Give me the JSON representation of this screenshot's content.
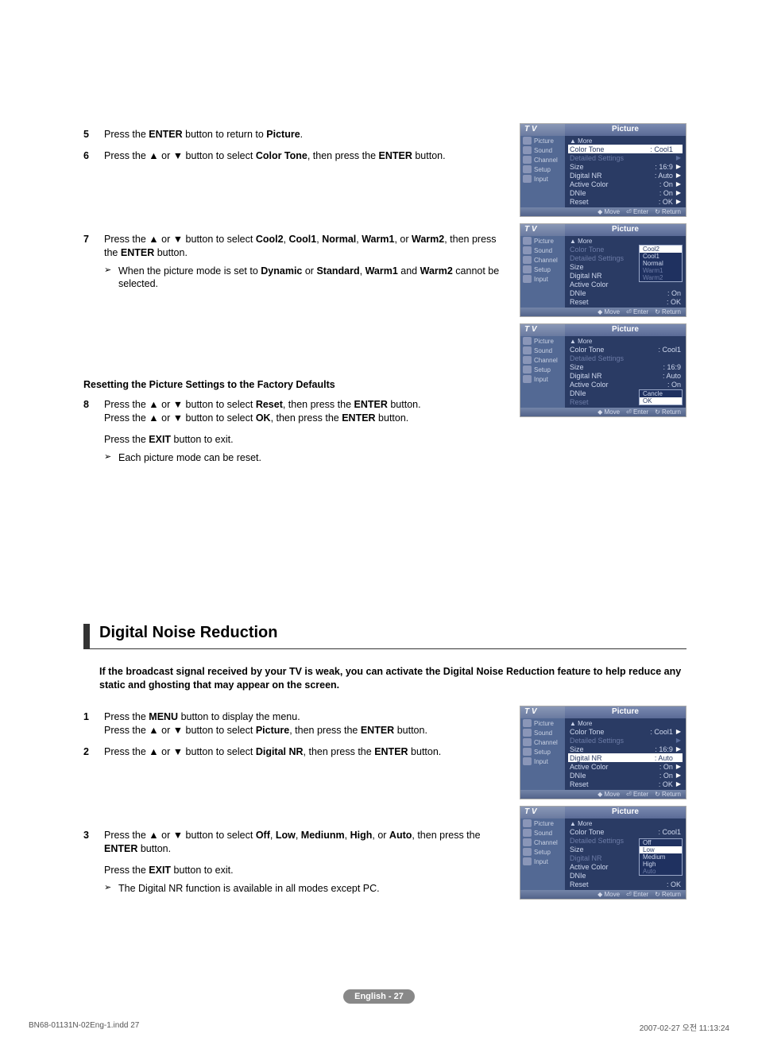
{
  "steps_top": [
    {
      "n": "5",
      "html": [
        "Press the ",
        [
          "b",
          "ENTER"
        ],
        " button to return to ",
        [
          "b",
          "Picture"
        ],
        "."
      ]
    },
    {
      "n": "6",
      "html": [
        "Press the ▲ or ▼ button to select ",
        [
          "b",
          "Color Tone"
        ],
        ", then press the ",
        [
          "b",
          "ENTER"
        ],
        " button."
      ]
    }
  ],
  "step7": {
    "n": "7",
    "html": [
      "Press the ▲ or ▼ button to select ",
      [
        "b",
        "Cool2"
      ],
      ", ",
      [
        "b",
        "Cool1"
      ],
      ", ",
      [
        "b",
        "Normal"
      ],
      ", ",
      [
        "b",
        "Warm1"
      ],
      ", or ",
      [
        "b",
        "Warm2"
      ],
      ", then press the ",
      [
        "b",
        "ENTER"
      ],
      " button."
    ],
    "sub": [
      "When the picture mode is set to ",
      [
        "b",
        "Dynamic"
      ],
      " or ",
      [
        "b",
        "Standard"
      ],
      ", ",
      [
        "b",
        "Warm1"
      ],
      " and ",
      [
        "b",
        "Warm2"
      ],
      " cannot be selected."
    ]
  },
  "reset_head": "Resetting the Picture Settings to the Factory Defaults",
  "step8": {
    "n": "8",
    "line1": [
      "Press the ▲ or ▼ button to select ",
      [
        "b",
        "Reset"
      ],
      ", then press the ",
      [
        "b",
        "ENTER"
      ],
      " button."
    ],
    "line2": [
      "Press the ▲ or ▼ button to select ",
      [
        "b",
        "OK"
      ],
      ", then press the ",
      [
        "b",
        "ENTER"
      ],
      " button."
    ],
    "exit": [
      "Press the ",
      [
        "b",
        "EXIT"
      ],
      " button to exit."
    ],
    "sub": [
      "Each picture mode can be reset."
    ]
  },
  "feature_title": "Digital Noise Reduction",
  "feature_intro": "If the broadcast signal received by your TV is weak, you can activate the Digital Noise Reduction feature to help reduce any static and ghosting that may appear on the screen.",
  "steps_dnr": [
    {
      "n": "1",
      "line1": [
        "Press the ",
        [
          "b",
          "MENU"
        ],
        " button to display the menu."
      ],
      "line2": [
        "Press the ▲ or ▼ button to select ",
        [
          "b",
          "Picture"
        ],
        ", then press the ",
        [
          "b",
          "ENTER"
        ],
        " button."
      ]
    },
    {
      "n": "2",
      "line1": [
        "Press the ▲ or ▼ button to select ",
        [
          "b",
          "Digital NR"
        ],
        ", then press the ",
        [
          "b",
          "ENTER"
        ],
        " button."
      ]
    }
  ],
  "step_dnr3": {
    "n": "3",
    "line1": [
      "Press the ▲ or ▼ button to select ",
      [
        "b",
        "Off"
      ],
      ", ",
      [
        "b",
        "Low"
      ],
      ", ",
      [
        "b",
        "Mediunm"
      ],
      ", ",
      [
        "b",
        "High"
      ],
      ", or ",
      [
        "b",
        "Auto"
      ],
      ", then press the ",
      [
        "b",
        "ENTER"
      ],
      " button."
    ],
    "exit": [
      "Press the ",
      [
        "b",
        "EXIT"
      ],
      " button to exit."
    ],
    "sub": [
      "The Digital NR function is available in all modes except PC."
    ]
  },
  "side_labels": [
    "Picture",
    "Sound",
    "Channel",
    "Setup",
    "Input"
  ],
  "osd": {
    "tv": "T V",
    "title": "Picture",
    "more": "▲ More",
    "bot": [
      "Move",
      "Enter",
      "Return"
    ]
  },
  "menu1_rows": [
    {
      "k": "Color Tone",
      "v": ": Cool1",
      "hi": true,
      "ar": true
    },
    {
      "k": "Detailed Settings",
      "v": "",
      "dim": true,
      "ar": true,
      "ardim": true
    },
    {
      "k": "Size",
      "v": ": 16:9",
      "ar": true
    },
    {
      "k": "Digital NR",
      "v": ": Auto",
      "ar": true
    },
    {
      "k": "Active Color",
      "v": ": On",
      "ar": true
    },
    {
      "k": "DNIe",
      "v": ": On",
      "ar": true
    },
    {
      "k": "Reset",
      "v": ": OK",
      "ar": true
    }
  ],
  "menu2_rows": [
    {
      "k": "Color Tone",
      "v": "",
      "dim": true
    },
    {
      "k": "Detailed Settings",
      "v": "",
      "dim": true
    },
    {
      "k": "Size",
      "v": ""
    },
    {
      "k": "Digital NR",
      "v": ""
    },
    {
      "k": "Active Color",
      "v": ""
    },
    {
      "k": "DNIe",
      "v": ": On"
    },
    {
      "k": "Reset",
      "v": ": OK"
    }
  ],
  "menu2_popup": [
    {
      "t": "Cool2",
      "hi": true
    },
    {
      "t": "Cool1"
    },
    {
      "t": "Normal"
    },
    {
      "t": "Warm1",
      "dim": true
    },
    {
      "t": "Warm2",
      "dim": true
    }
  ],
  "menu3_rows": [
    {
      "k": "Color Tone",
      "v": ": Cool1"
    },
    {
      "k": "Detailed Settings",
      "v": "",
      "dim": true
    },
    {
      "k": "Size",
      "v": ": 16:9"
    },
    {
      "k": "Digital NR",
      "v": ": Auto"
    },
    {
      "k": "Active Color",
      "v": ": On"
    },
    {
      "k": "DNIe",
      "v": ""
    },
    {
      "k": "Reset",
      "v": "",
      "dim": true
    }
  ],
  "menu3_popup": [
    {
      "t": "Cancle"
    },
    {
      "t": "OK",
      "hi": true
    }
  ],
  "menu4_rows": [
    {
      "k": "Color Tone",
      "v": ": Cool1",
      "ar": true
    },
    {
      "k": "Detailed Settings",
      "v": "",
      "dim": true,
      "ar": true,
      "ardim": true
    },
    {
      "k": "Size",
      "v": ": 16:9",
      "ar": true
    },
    {
      "k": "Digital NR",
      "v": ": Auto",
      "hi": true,
      "ar": true
    },
    {
      "k": "Active Color",
      "v": ": On",
      "ar": true
    },
    {
      "k": "DNIe",
      "v": ": On",
      "ar": true
    },
    {
      "k": "Reset",
      "v": ": OK",
      "ar": true
    }
  ],
  "menu5_rows": [
    {
      "k": "Color Tone",
      "v": ": Cool1"
    },
    {
      "k": "Detailed Settings",
      "v": "",
      "dim": true
    },
    {
      "k": "Size",
      "v": ""
    },
    {
      "k": "Digital NR",
      "v": "",
      "dim": true
    },
    {
      "k": "Active Color",
      "v": ""
    },
    {
      "k": "DNIe",
      "v": ""
    },
    {
      "k": "Reset",
      "v": ": OK"
    }
  ],
  "menu5_popup": [
    {
      "t": "Off"
    },
    {
      "t": "Low",
      "hi": true
    },
    {
      "t": "Medium"
    },
    {
      "t": "High"
    },
    {
      "t": "Auto",
      "dim": true
    }
  ],
  "page_num": "English - 27",
  "footer_left": "BN68-01131N-02Eng-1.indd   27",
  "footer_right": "2007-02-27   오전 11:13:24"
}
